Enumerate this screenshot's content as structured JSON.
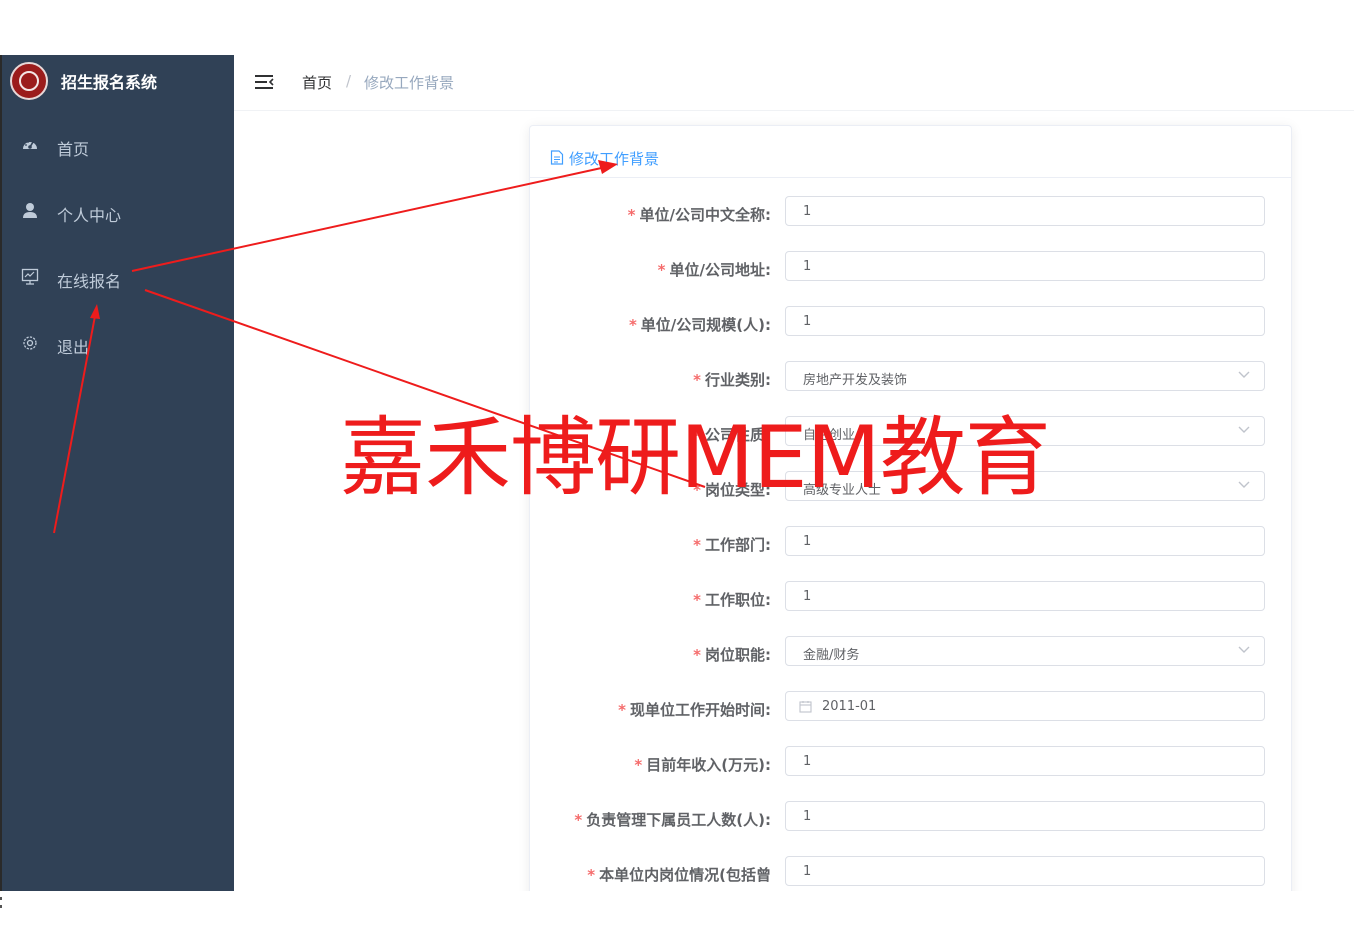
{
  "sidebar": {
    "title": "招生报名系统",
    "items": [
      {
        "label": "首页",
        "icon": "dashboard-icon"
      },
      {
        "label": "个人中心",
        "icon": "user-icon"
      },
      {
        "label": "在线报名",
        "icon": "monitor-chart-icon"
      },
      {
        "label": "退出",
        "icon": "gear-icon"
      }
    ]
  },
  "navbar": {
    "breadcrumb_home": "首页",
    "breadcrumb_sep": "/",
    "breadcrumb_current": "修改工作背景"
  },
  "card": {
    "title": "修改工作背景",
    "fields": [
      {
        "label": "单位/公司中文全称:",
        "value": "1",
        "type": "input"
      },
      {
        "label": "单位/公司地址:",
        "value": "1",
        "type": "input"
      },
      {
        "label": "单位/公司规模(人):",
        "value": "1",
        "type": "input"
      },
      {
        "label": "行业类别:",
        "value": "房地产开发及装饰",
        "type": "select"
      },
      {
        "label": "公司性质:",
        "value": "自主创业",
        "type": "select"
      },
      {
        "label": "岗位类型:",
        "value": "高级专业人士",
        "type": "select"
      },
      {
        "label": "工作部门:",
        "value": "1",
        "type": "input"
      },
      {
        "label": "工作职位:",
        "value": "1",
        "type": "input"
      },
      {
        "label": "岗位职能:",
        "value": "金融/财务",
        "type": "select"
      },
      {
        "label": "现单位工作开始时间:",
        "value": "2011-01",
        "type": "date"
      },
      {
        "label": "目前年收入(万元):",
        "value": "1",
        "type": "input"
      },
      {
        "label": "负责管理下属员工人数(人):",
        "value": "1",
        "type": "input"
      },
      {
        "label": "本单位内岗位情况(包括曾",
        "value": "1",
        "type": "input"
      }
    ]
  },
  "watermark": "嘉禾博研MEM教育",
  "colors": {
    "sidebar_bg": "#304156",
    "sidebar_text": "#bfcbd9",
    "accent": "#409eff",
    "required": "#f56c6c",
    "annotation_red": "#ee1c1c"
  }
}
